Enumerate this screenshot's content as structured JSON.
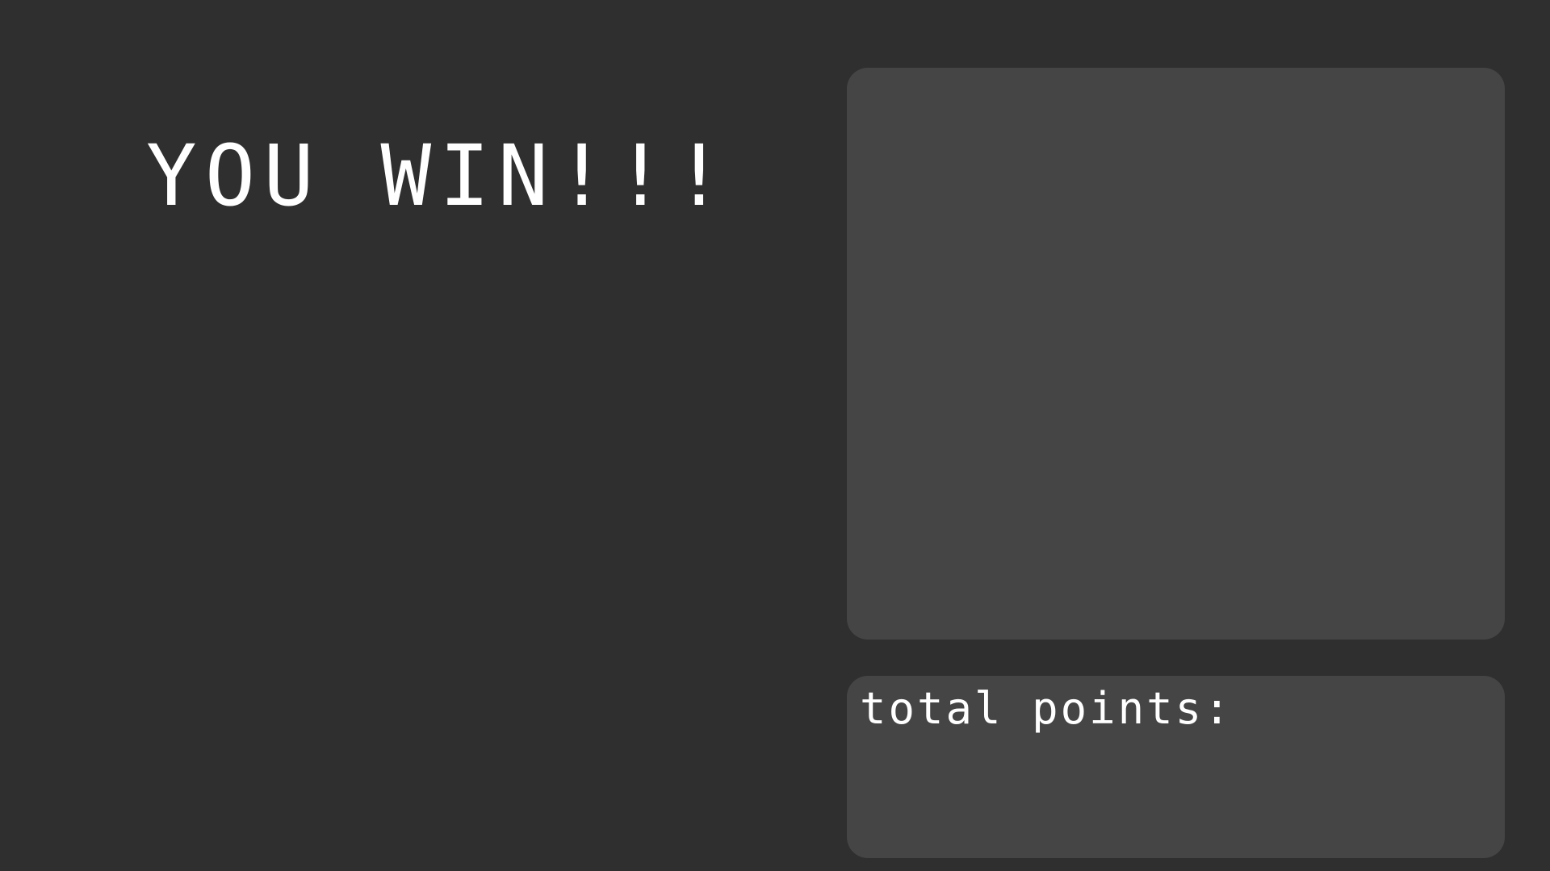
{
  "title": "YOU WIN!!!",
  "points_panel": {
    "label": "total points:"
  },
  "colors": {
    "background": "#2f2f2f",
    "panel": "#454545",
    "text": "#ffffff"
  }
}
